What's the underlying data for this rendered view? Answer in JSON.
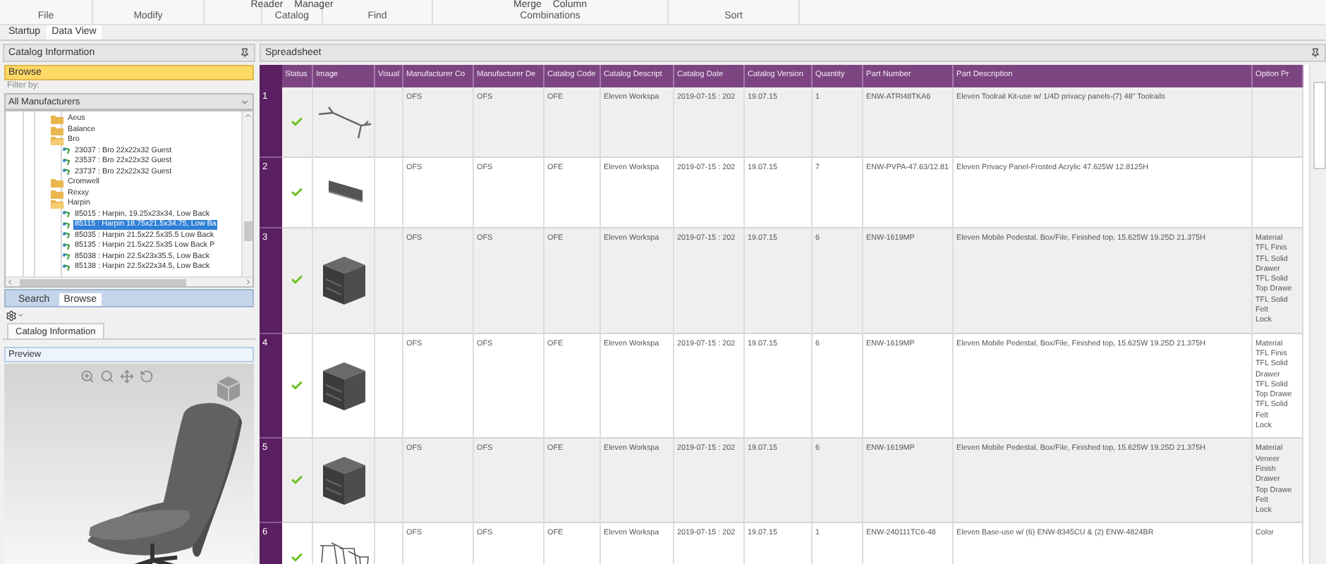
{
  "ribbon": {
    "groups": [
      {
        "label": "File"
      },
      {
        "label": "Modify"
      },
      {
        "label": "Catalog",
        "buttons": [
          "Reader",
          "Manager"
        ]
      },
      {
        "label": "Find"
      },
      {
        "label": "Combinations",
        "buttons": [
          "Merge",
          "Column"
        ]
      },
      {
        "label": "Sort"
      }
    ]
  },
  "document_tabs": [
    {
      "label": "Startup",
      "selected": false
    },
    {
      "label": "Data View",
      "selected": true
    }
  ],
  "catalog_panel": {
    "title": "Catalog Information",
    "browse_label": "Browse",
    "filter_label": "Filter by:",
    "filter_value": "All Manufacturers",
    "tree": [
      {
        "kind": "folder",
        "label": "Aeus",
        "expanded": false,
        "selected": false
      },
      {
        "kind": "folder",
        "label": "Balance",
        "expanded": false,
        "selected": false
      },
      {
        "kind": "folder",
        "label": "Bro",
        "expanded": true,
        "selected": false,
        "children": [
          {
            "kind": "item",
            "label": "23037 : Bro 22x22x32 Guest",
            "selected": false
          },
          {
            "kind": "item",
            "label": "23537 : Bro 22x22x32 Guest",
            "selected": false
          },
          {
            "kind": "item",
            "label": "23737 : Bro 22x22x32 Guest",
            "selected": false
          }
        ]
      },
      {
        "kind": "folder",
        "label": "Cromwell",
        "expanded": false,
        "selected": false
      },
      {
        "kind": "folder",
        "label": "Rexxy",
        "expanded": false,
        "selected": false
      },
      {
        "kind": "folder",
        "label": "Harpin",
        "expanded": true,
        "selected": false,
        "children": [
          {
            "kind": "item",
            "label": "85015 : Harpin, 19.25x23x34, Low Back",
            "selected": false
          },
          {
            "kind": "item",
            "label": "85115 : Harpin 18.75x21.5x34.75, Low Ba",
            "selected": true
          },
          {
            "kind": "item",
            "label": "85035 : Harpin 21.5x22.5x35.5 Low Back",
            "selected": false
          },
          {
            "kind": "item",
            "label": "85135 : Harpin 21.5x22.5x35 Low Back P",
            "selected": false
          },
          {
            "kind": "item",
            "label": "85038 : Harpin 22.5x23x35.5, Low Back",
            "selected": false
          },
          {
            "kind": "item",
            "label": "85138 : Harpin 22.5x22x34.5, Low Back",
            "selected": false
          }
        ]
      }
    ],
    "tabs": [
      {
        "label": "Search",
        "selected": false
      },
      {
        "label": "Browse",
        "selected": true
      }
    ],
    "bottom_tabs": [
      {
        "label": "Catalog Information",
        "selected": true
      }
    ],
    "preview_title": "Preview"
  },
  "spreadsheet": {
    "title": "Spreadsheet",
    "columns": [
      "Status",
      "Image",
      "Visual",
      "Manufacturer Co",
      "Manufacturer De",
      "Catalog Code",
      "Catalog Descript",
      "Catalog Date",
      "Catalog Version",
      "Quantity",
      "Part Number",
      "Part Description",
      "Option Pr"
    ],
    "rows": [
      {
        "number": "1",
        "status_ok": true,
        "kind": "toolrail",
        "cells": [
          "",
          "",
          "",
          "OFS",
          "OFS",
          "OFE",
          "Eleven Workspa",
          "2019-07-15 : 202",
          "19.07.15",
          "1",
          "ENW-ATRI48TKA6",
          "Eleven Toolrail Kit-use w/ 1/4D privacy panels-(7) 48\" Toolrails"
        ]
      },
      {
        "number": "2",
        "status_ok": true,
        "kind": "panel",
        "cells": [
          "",
          "",
          "",
          "OFS",
          "OFS",
          "OFE",
          "Eleven Workspa",
          "2019-07-15 : 202",
          "19.07.15",
          "7",
          "ENW-PVPA-47.63/12.81",
          "Eleven Privacy Panel-Frosted Acrylic 47.625W 12.8125H"
        ]
      },
      {
        "number": "3",
        "status_ok": true,
        "kind": "pedestal",
        "cells": [
          "",
          "",
          "",
          "OFS",
          "OFS",
          "OFE",
          "Eleven Workspa",
          "2019-07-15 : 202",
          "19.07.15",
          "6",
          "ENW-1619MP",
          "Eleven Mobile Pedestal, Box/File, Finished top, 15.625W 19.25D 21.375H"
        ],
        "options": [
          "Material",
          "TFL Finis",
          "TFL Solid",
          "Drawer",
          "TFL Solid",
          "Top Drawe",
          "TFL Solid",
          "Felt",
          "Lock"
        ]
      },
      {
        "number": "4",
        "status_ok": true,
        "kind": "pedestal",
        "cells": [
          "",
          "",
          "",
          "OFS",
          "OFS",
          "OFE",
          "Eleven Workspa",
          "2019-07-15 : 202",
          "19.07.15",
          "6",
          "ENW-1619MP",
          "Eleven Mobile Pedestal, Box/File, Finished top, 15.625W 19.25D 21.375H"
        ],
        "options": [
          "Material",
          "TFL Finis",
          "TFL Solid",
          "Drawer",
          "TFL Solid",
          "Top Drawe",
          "TFL Solid",
          "Felt",
          "Lock"
        ]
      },
      {
        "number": "5",
        "status_ok": true,
        "kind": "pedestal",
        "cells": [
          "",
          "",
          "",
          "OFS",
          "OFS",
          "OFE",
          "Eleven Workspa",
          "2019-07-15 : 202",
          "19.07.15",
          "6",
          "ENW-1619MP",
          "Eleven Mobile Pedestal, Box/File, Finished top, 15.625W 19.25D 21.375H"
        ],
        "options": [
          "Material",
          "Veneer",
          "Finish",
          "Drawer",
          "Top Drawe",
          "Felt",
          "Lock"
        ]
      },
      {
        "number": "6",
        "status_ok": true,
        "kind": "base",
        "cells": [
          "",
          "",
          "",
          "OFS",
          "OFS",
          "OFE",
          "Eleven Workspa",
          "2019-07-15 : 202",
          "19.07.15",
          "1",
          "ENW-240111TC6-48",
          "Eleven Base-use w/ (6) ENW-8345CU & (2) ENW-4824BR"
        ],
        "options": [
          "Color"
        ]
      }
    ]
  }
}
